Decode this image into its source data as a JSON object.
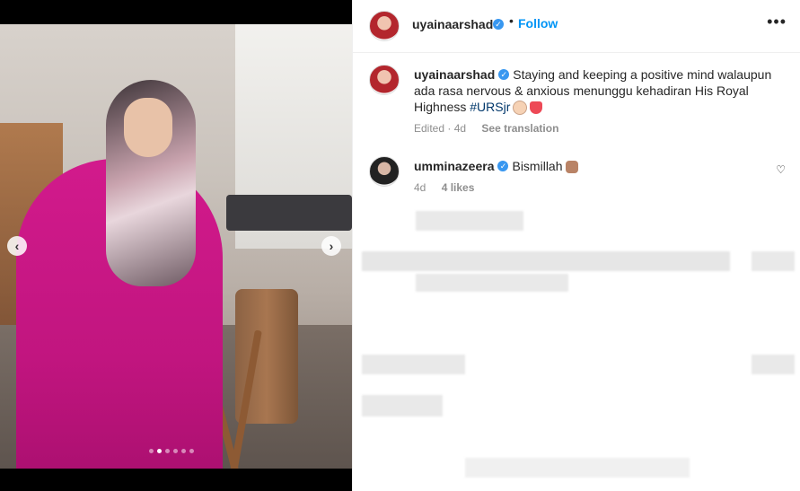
{
  "post": {
    "username": "uyainaarshad",
    "follow_label": "Follow",
    "more_label": "•••",
    "caption": {
      "username": "uyainaarshad",
      "text": "Staying and keeping a positive mind walaupun ada rasa nervous & anxious menunggu kehadiran His Royal Highness ",
      "hashtag": "#URSjr",
      "meta_time": "Edited · 4d",
      "see_translation": "See translation"
    },
    "comments": [
      {
        "username": "umminazeera",
        "text": "Bismillah",
        "time": "4d",
        "likes": "4 likes"
      }
    ]
  },
  "media": {
    "prev_label": "‹",
    "next_label": "›",
    "dot_count": 6,
    "active_dot": 1
  },
  "icons": {
    "verified": "verified-badge-icon",
    "heart": "heart-outline-icon",
    "more": "more-horizontal-icon"
  },
  "colors": {
    "link_blue": "#0095f6",
    "verified_blue": "#3897f0",
    "hashtag": "#00376b",
    "dress_pink": "#c1157f"
  }
}
